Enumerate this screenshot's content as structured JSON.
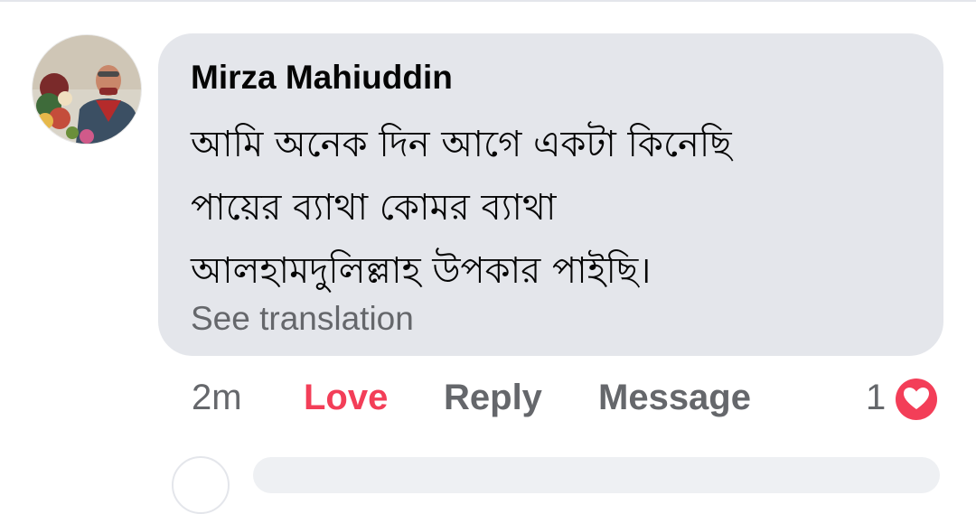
{
  "comment": {
    "author": "Mirza Mahiuddin",
    "lines": [
      "আমি অনেক দিন আগে একটা কিনেছি",
      "পায়ের ব্যাথা কোমর ব্যাথা",
      "আলহামদুলিল্লাহ উপকার পাইছি।"
    ],
    "see_translation": "See translation",
    "time": "2m",
    "love_label": "Love",
    "reply_label": "Reply",
    "message_label": "Message",
    "reaction_count": "1",
    "reaction_icon": "love-heart-icon"
  },
  "colors": {
    "bubble": "#e4e6eb",
    "love": "#f33e58",
    "secondary_text": "#65676b",
    "primary_text": "#050505"
  }
}
